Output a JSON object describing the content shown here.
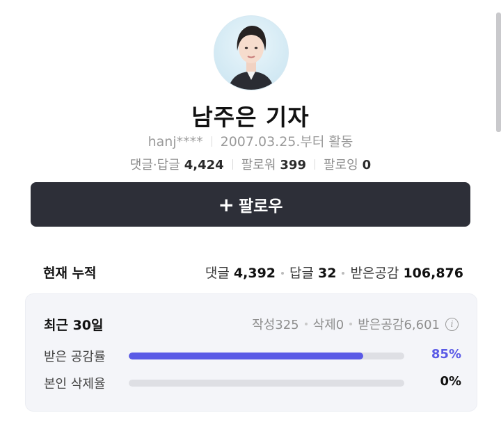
{
  "profile": {
    "name": "남주은 기자",
    "user_id": "hanj****",
    "active_since": "2007.03.25.부터 활동",
    "stats": [
      {
        "label": "댓글·답글",
        "value": "4,424"
      },
      {
        "label": "팔로워",
        "value": "399"
      },
      {
        "label": "팔로잉",
        "value": "0"
      }
    ]
  },
  "follow_button": {
    "icon": "+",
    "label": "팔로우"
  },
  "totals": {
    "label": "현재 누적",
    "items": [
      {
        "label": "댓글",
        "value": "4,392"
      },
      {
        "label": "답글",
        "value": "32"
      },
      {
        "label": "받은공감",
        "value": "106,876"
      }
    ]
  },
  "recent": {
    "label": "최근 30일",
    "items": [
      {
        "label": "작성",
        "value": "325"
      },
      {
        "label": "삭제",
        "value": "0"
      },
      {
        "label": "받은공감",
        "value": "6,601"
      }
    ],
    "info_icon": "info-icon",
    "bars": [
      {
        "label": "받은 공감률",
        "value_text": "85%",
        "fraction": 0.85,
        "color": "#5a5ae6"
      },
      {
        "label": "본인 삭제율",
        "value_text": "0%",
        "fraction": 0.0,
        "color": "#5a5ae6"
      }
    ]
  },
  "colors": {
    "accent": "#5a5ae6",
    "button_bg": "#2d2f38",
    "card_bg": "#f4f5f9"
  }
}
